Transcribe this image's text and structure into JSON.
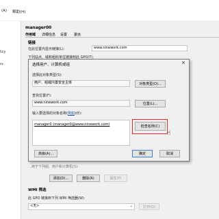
{
  "menu": [
    "(A)",
    "帮助(H)"
  ],
  "left_panel": [
    "licy",
    "rs"
  ],
  "gpo": {
    "title": "manager00",
    "tabs": [
      "作用域",
      "详细信息",
      "设置",
      "委派"
    ],
    "link_section": "链接",
    "show_links_label": "在此位置内显示链接(L):",
    "show_links_value": "www.ninework.com",
    "linked_label": "下列站点、域和组织单位链接到此 GPO(T):",
    "security_partial": "…用于下列组、用户和计算机(S):",
    "security_add": "添加(D)...",
    "security_remove": "删除(R)",
    "security_props": "属性(P)",
    "wmi_section": "WMI 筛选",
    "wmi_label": "此 GPO 链接到下列 WMI 筛选器(W):",
    "wmi_value": "<无>",
    "open_button": "打开(O)"
  },
  "dialog": {
    "title": "选择用户、计算机或组",
    "object_type_label": "选择此对象类型(S):",
    "object_type_value": "用户、组或内置安全主体",
    "object_type_button": "对象类型(O)...",
    "location_label": "查找位置(F):",
    "location_value": "www.ninework.com",
    "location_button": "位置(L)...",
    "enter_label": "输入要选择的对象名称(",
    "enter_link": "例如",
    "enter_label_end": ")(E):",
    "entered_value": "manager0 (manager0@www.ninework.com)",
    "check_names_button": "检查名称(C)",
    "advanced_button": "高级(A)...",
    "ok_button": "确定",
    "cancel_button": "取消"
  },
  "colors": {
    "highlight": "#e0262c",
    "link": "#1a4fa0"
  }
}
